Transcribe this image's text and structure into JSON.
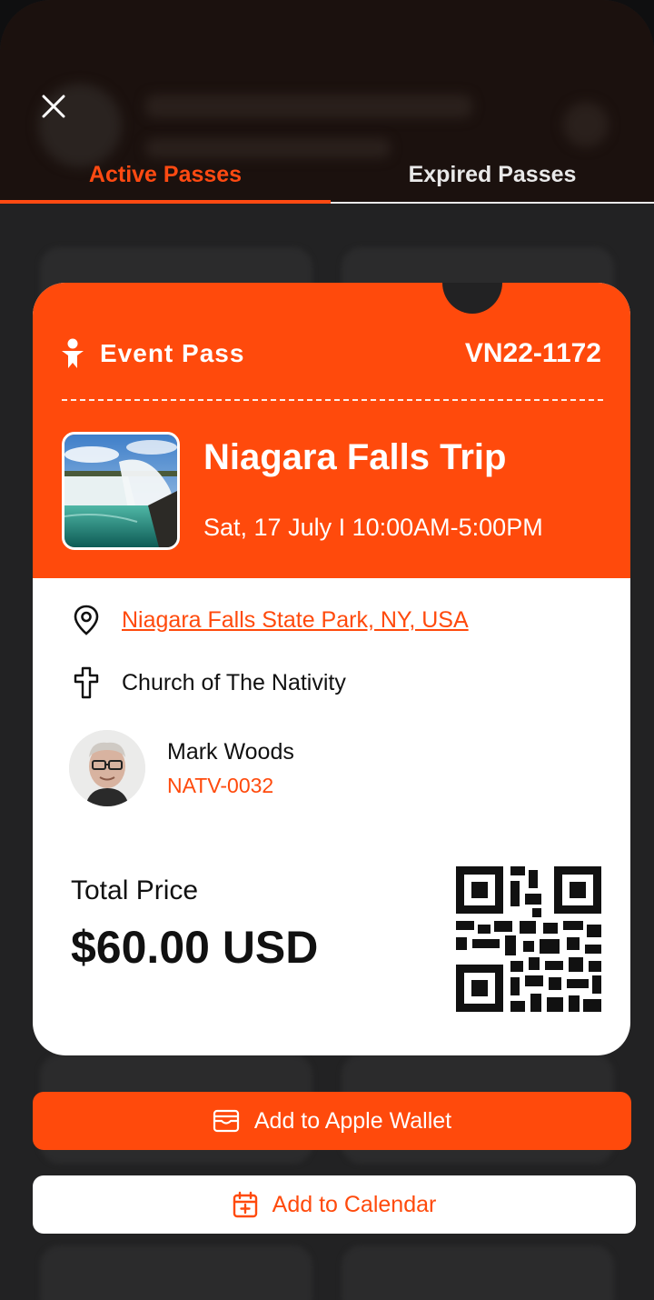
{
  "header": {
    "close_icon": "close-icon"
  },
  "tabs": [
    {
      "label": "Active Passes",
      "active": true
    },
    {
      "label": "Expired Passes",
      "active": false
    }
  ],
  "pass": {
    "type_label": "Event Pass",
    "code": "VN22-1172",
    "event_title": "Niagara Falls Trip",
    "event_time": "Sat, 17 July I 10:00AM-5:00PM",
    "location": "Niagara Falls State Park, NY, USA",
    "church": "Church of The Nativity",
    "person_name": "Mark Woods",
    "person_id": "NATV-0032",
    "price_label": "Total Price",
    "price_value": "$60.00 USD"
  },
  "actions": {
    "wallet_label": "Add to Apple Wallet",
    "calendar_label": "Add to Calendar"
  },
  "colors": {
    "accent": "#ff4a0c",
    "background": "#222223",
    "card": "#ffffff"
  }
}
